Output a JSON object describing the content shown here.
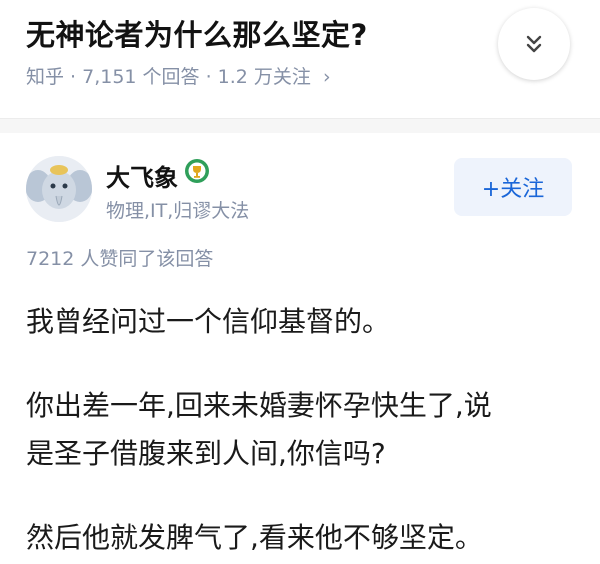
{
  "question": {
    "title": "无神论者为什么那么坚定?",
    "meta": "知乎 · 7,151 个回答 · 1.2 万关注",
    "meta_chevron": "›",
    "collapse_icon": "double-chevron-down-icon"
  },
  "author": {
    "name": "大飞象",
    "badge_icon": "trophy-badge-icon",
    "bio": "物理,IT,归谬大法",
    "follow_label": "+关注"
  },
  "answer": {
    "vote_line": "7212 人赞同了该回答",
    "paragraphs": [
      "我曾经问过一个信仰基督的。",
      "你出差一年,回来未婚妻怀孕快生了,说",
      "是圣子借腹来到人间,你信吗?",
      "然后他就发脾气了,看来他不够坚定。"
    ]
  },
  "colors": {
    "accent": "#1a66d8",
    "muted_text": "#8590a6",
    "badge_green": "#2f9f5a"
  }
}
